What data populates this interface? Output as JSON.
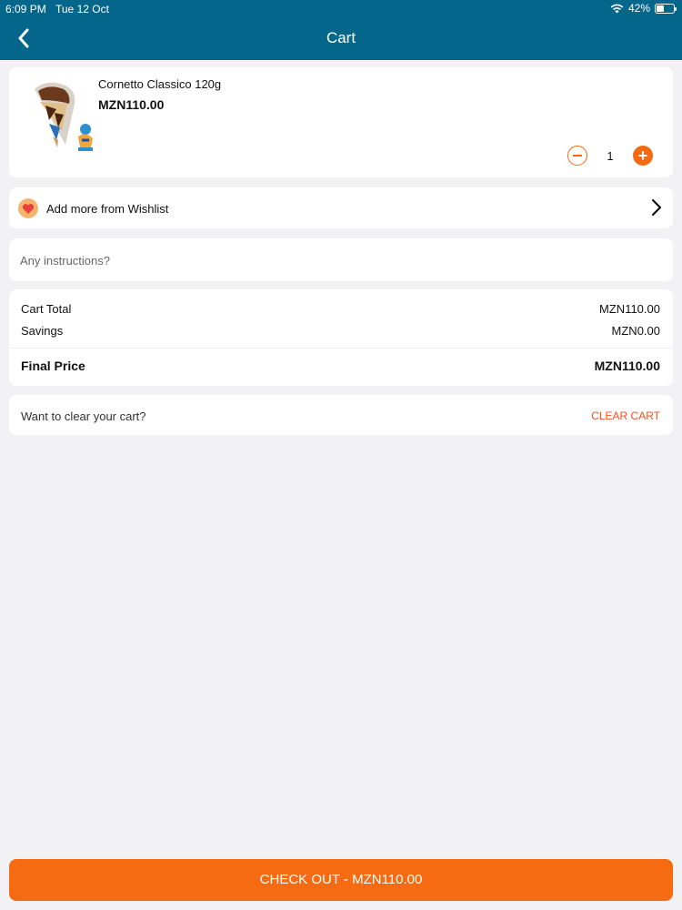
{
  "status_bar": {
    "time": "6:09 PM",
    "date": "Tue 12 Oct",
    "battery": "42%",
    "battery_level": 0.42
  },
  "header": {
    "title": "Cart",
    "back_icon": "chevron-left-icon"
  },
  "cart_item": {
    "name": "Cornetto Classico 120g",
    "price": "MZN110.00",
    "quantity": "1",
    "minus_icon": "minus-circle-icon",
    "plus_icon": "plus-circle-icon"
  },
  "wishlist": {
    "label": "Add more from Wishlist",
    "icon": "heart-icon",
    "chevron_icon": "chevron-right-icon"
  },
  "instructions": {
    "placeholder": "Any instructions?",
    "value": ""
  },
  "totals": {
    "cart_total_label": "Cart Total",
    "cart_total_value": "MZN110.00",
    "savings_label": "Savings",
    "savings_value": "MZN0.00",
    "final_label": "Final Price",
    "final_value": "MZN110.00"
  },
  "clear_cart": {
    "prompt": "Want to clear your cart?",
    "button_label": "CLEAR CART"
  },
  "checkout": {
    "label": "CHECK OUT - MZN110.00"
  },
  "colors": {
    "header": "#05668c",
    "accent": "#f66b11",
    "clear": "#f0521e",
    "background": "#f2f2f4"
  }
}
